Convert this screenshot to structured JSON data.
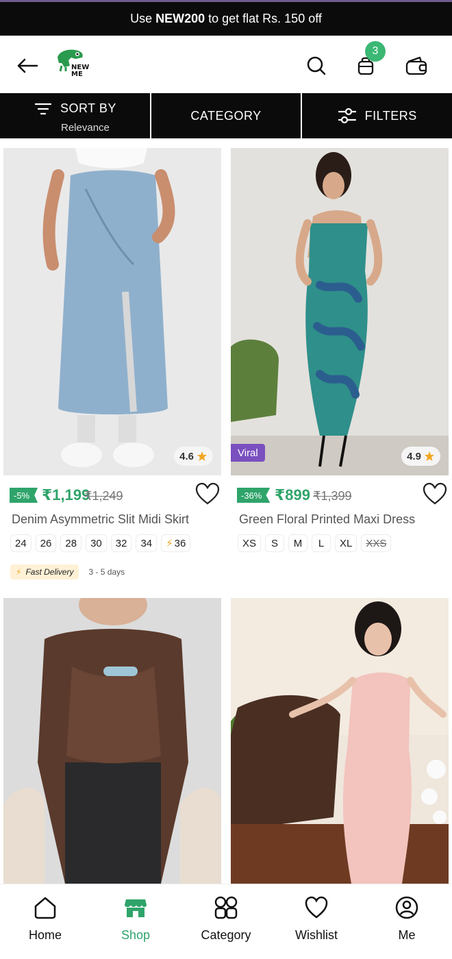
{
  "promo": {
    "prefix": "Use",
    "code": "NEW200",
    "suffix": "to get flat Rs. 150 off"
  },
  "header": {
    "logo_text_1": "NEW",
    "logo_text_2": "ME",
    "cart_count": "3"
  },
  "sortbar": {
    "sort_label": "SORT BY",
    "sort_value": "Relevance",
    "category_label": "CATEGORY",
    "filters_label": "FILTERS"
  },
  "products": [
    {
      "name": "Denim Asymmetric Slit Midi Skirt",
      "discount": "-5%",
      "price": "₹1,199",
      "mrp": "₹1,249",
      "rating": "4.6",
      "sizes": [
        "24",
        "26",
        "28",
        "30",
        "32",
        "34",
        "36"
      ],
      "delivery_label": "Fast Delivery",
      "delivery_time": "3 - 5 days"
    },
    {
      "name": "Green Floral Printed Maxi Dress",
      "discount": "-36%",
      "price": "₹899",
      "mrp": "₹1,399",
      "rating": "4.9",
      "badge": "Viral",
      "sizes": [
        "XS",
        "S",
        "M",
        "L",
        "XL",
        "XXS"
      ]
    }
  ],
  "nav": [
    {
      "label": "Home",
      "icon": "home-icon"
    },
    {
      "label": "Shop",
      "icon": "shop-icon"
    },
    {
      "label": "Category",
      "icon": "category-icon"
    },
    {
      "label": "Wishlist",
      "icon": "heart-icon"
    },
    {
      "label": "Me",
      "icon": "user-icon"
    }
  ],
  "colors": {
    "accent": "#2fa46a",
    "badge": "#3bb874",
    "viral": "#7a4fbf",
    "bar": "#0b0b0b"
  }
}
